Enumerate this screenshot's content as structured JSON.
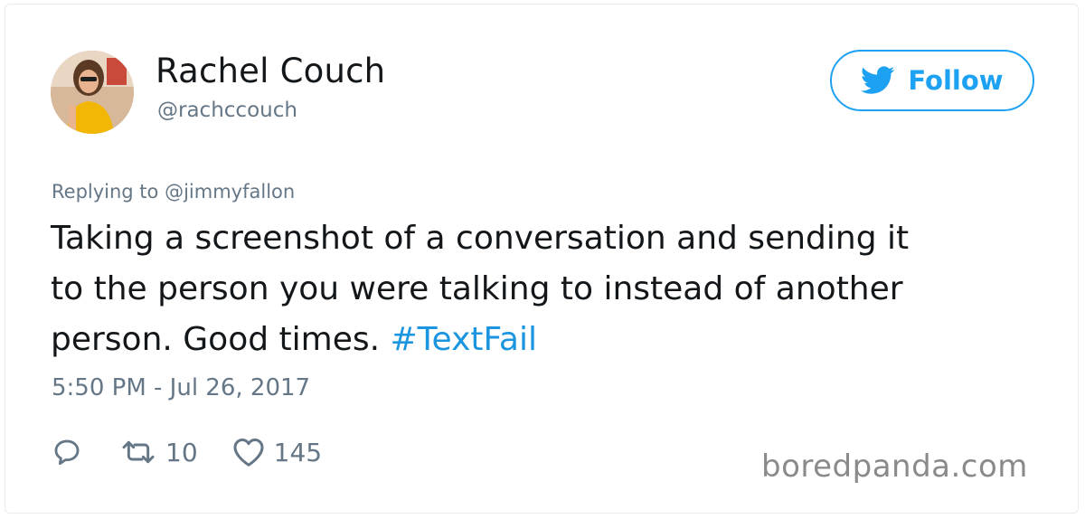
{
  "tweet": {
    "author": {
      "display_name": "Rachel Couch",
      "handle": "@rachccouch",
      "avatar_icon": "profile-photo"
    },
    "follow_button": {
      "label": "Follow",
      "icon": "twitter-bird-icon"
    },
    "replying_to": {
      "prefix": "Replying to",
      "mention": "@jimmyfallon"
    },
    "text_lines": [
      "Taking a screenshot of a conversation and sending it",
      "to the person you were talking to instead of another",
      "person. Good times."
    ],
    "hashtag": "#TextFail",
    "timestamp": "5:50 PM - Jul 26, 2017",
    "actions": {
      "reply": {
        "icon": "reply-icon"
      },
      "retweet": {
        "icon": "retweet-icon",
        "count": "10"
      },
      "like": {
        "icon": "heart-icon",
        "count": "145"
      }
    }
  },
  "watermark": "boredpanda.com",
  "colors": {
    "accent": "#1da1f2",
    "hashtag": "#1b95e0",
    "text": "#14171a",
    "muted": "#657786"
  }
}
